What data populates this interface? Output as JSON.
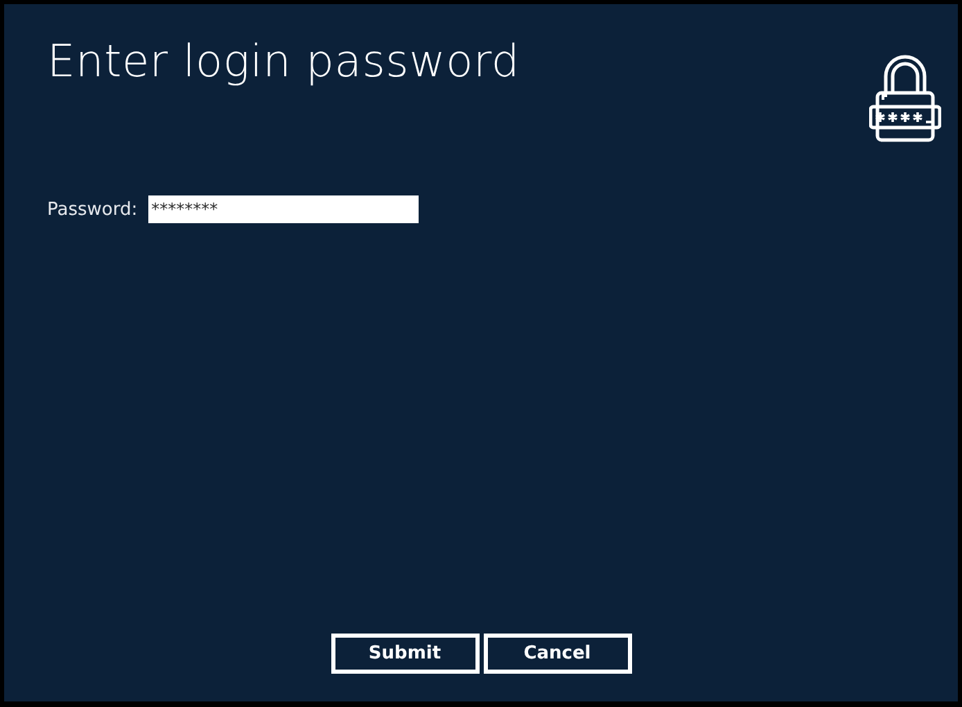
{
  "title": "Enter login password",
  "password_field": {
    "label": "Password:",
    "value": "********"
  },
  "buttons": [
    {
      "label": "Submit"
    },
    {
      "label": "Cancel"
    }
  ]
}
